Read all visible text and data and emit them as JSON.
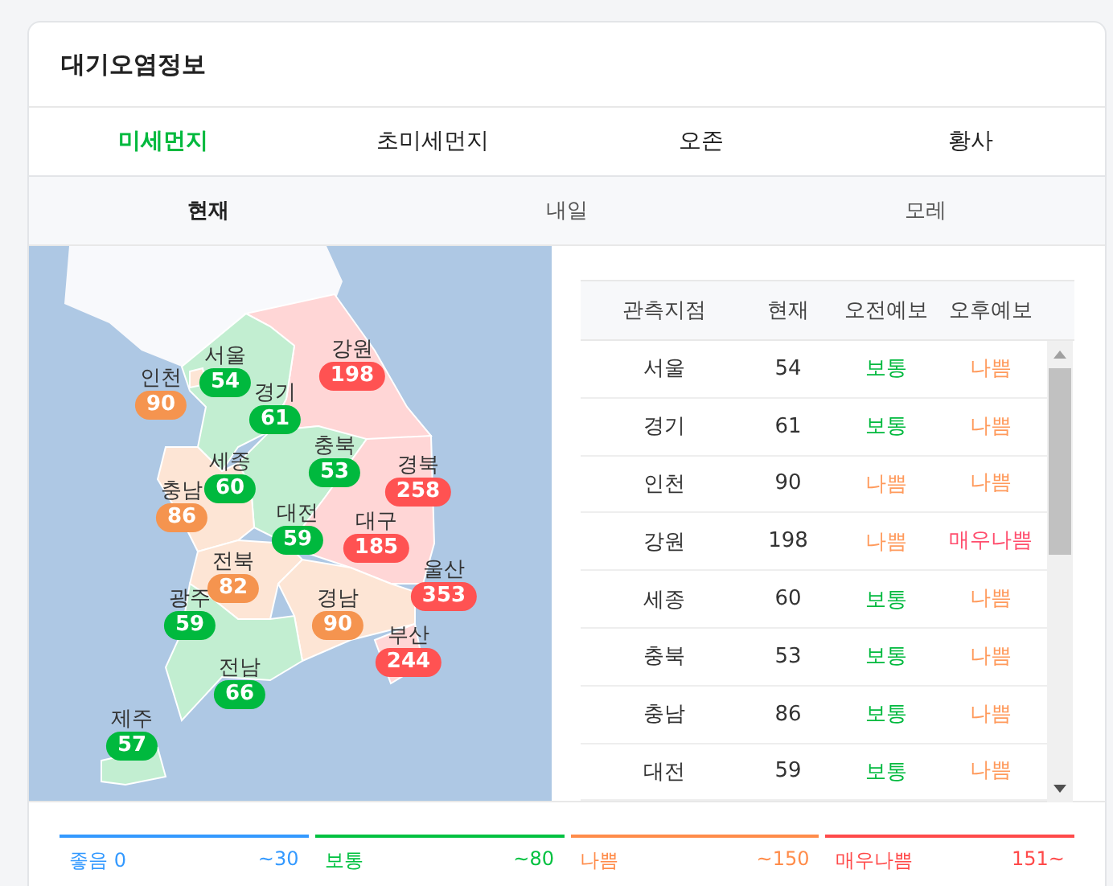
{
  "card": {
    "title": "대기오염정보"
  },
  "tabs": [
    {
      "label": "미세먼지",
      "selected": true
    },
    {
      "label": "초미세먼지",
      "selected": false
    },
    {
      "label": "오존",
      "selected": false
    },
    {
      "label": "황사",
      "selected": false
    }
  ],
  "day_tabs": [
    {
      "label": "현재",
      "selected": true
    },
    {
      "label": "내일",
      "selected": false
    },
    {
      "label": "모레",
      "selected": false
    }
  ],
  "map_markers": [
    {
      "name": "서울",
      "value": "54",
      "color": "#00b93e"
    },
    {
      "name": "인천",
      "value": "90",
      "color": "#f5944f"
    },
    {
      "name": "강원",
      "value": "198",
      "color": "#ff5252"
    },
    {
      "name": "경기",
      "value": "61",
      "color": "#00b93e"
    },
    {
      "name": "충북",
      "value": "53",
      "color": "#00b93e"
    },
    {
      "name": "세종",
      "value": "60",
      "color": "#00b93e"
    },
    {
      "name": "경북",
      "value": "258",
      "color": "#ff5252"
    },
    {
      "name": "충남",
      "value": "86",
      "color": "#f5944f"
    },
    {
      "name": "대전",
      "value": "59",
      "color": "#00b93e"
    },
    {
      "name": "대구",
      "value": "185",
      "color": "#ff5252"
    },
    {
      "name": "전북",
      "value": "82",
      "color": "#f5944f"
    },
    {
      "name": "울산",
      "value": "353",
      "color": "#ff5252"
    },
    {
      "name": "광주",
      "value": "59",
      "color": "#00b93e"
    },
    {
      "name": "경남",
      "value": "90",
      "color": "#f5944f"
    },
    {
      "name": "부산",
      "value": "244",
      "color": "#ff5252"
    },
    {
      "name": "전남",
      "value": "66",
      "color": "#00b93e"
    },
    {
      "name": "제주",
      "value": "57",
      "color": "#00b93e"
    }
  ],
  "table": {
    "columns": [
      "관측지점",
      "현재",
      "오전예보",
      "오후예보"
    ],
    "rows": [
      {
        "site": "서울",
        "current": "54",
        "am": {
          "text": "보통",
          "color": "#00b93e"
        },
        "pm": {
          "text": "나쁨",
          "color": "#ff9a5c"
        }
      },
      {
        "site": "경기",
        "current": "61",
        "am": {
          "text": "보통",
          "color": "#00b93e"
        },
        "pm": {
          "text": "나쁨",
          "color": "#ff9a5c"
        }
      },
      {
        "site": "인천",
        "current": "90",
        "am": {
          "text": "나쁨",
          "color": "#ff9a5c"
        },
        "pm": {
          "text": "나쁨",
          "color": "#ff9a5c"
        }
      },
      {
        "site": "강원",
        "current": "198",
        "am": {
          "text": "나쁨",
          "color": "#ff9a5c"
        },
        "pm": {
          "text": "매우나쁨",
          "color": "#ff4d6d"
        }
      },
      {
        "site": "세종",
        "current": "60",
        "am": {
          "text": "보통",
          "color": "#00b93e"
        },
        "pm": {
          "text": "나쁨",
          "color": "#ff9a5c"
        }
      },
      {
        "site": "충북",
        "current": "53",
        "am": {
          "text": "보통",
          "color": "#00b93e"
        },
        "pm": {
          "text": "나쁨",
          "color": "#ff9a5c"
        }
      },
      {
        "site": "충남",
        "current": "86",
        "am": {
          "text": "보통",
          "color": "#00b93e"
        },
        "pm": {
          "text": "나쁨",
          "color": "#ff9a5c"
        }
      },
      {
        "site": "대전",
        "current": "59",
        "am": {
          "text": "보통",
          "color": "#00b93e"
        },
        "pm": {
          "text": "나쁨",
          "color": "#ff9a5c"
        }
      }
    ]
  },
  "legend": [
    {
      "label": "좋음 0",
      "range": "~30",
      "color": "#3399ff"
    },
    {
      "label": "보통",
      "range": "~80",
      "color": "#00c140"
    },
    {
      "label": "나쁨",
      "range": "~150",
      "color": "#ff8c4a"
    },
    {
      "label": "매우나쁨",
      "range": "151~",
      "color": "#ff4a4a"
    }
  ]
}
